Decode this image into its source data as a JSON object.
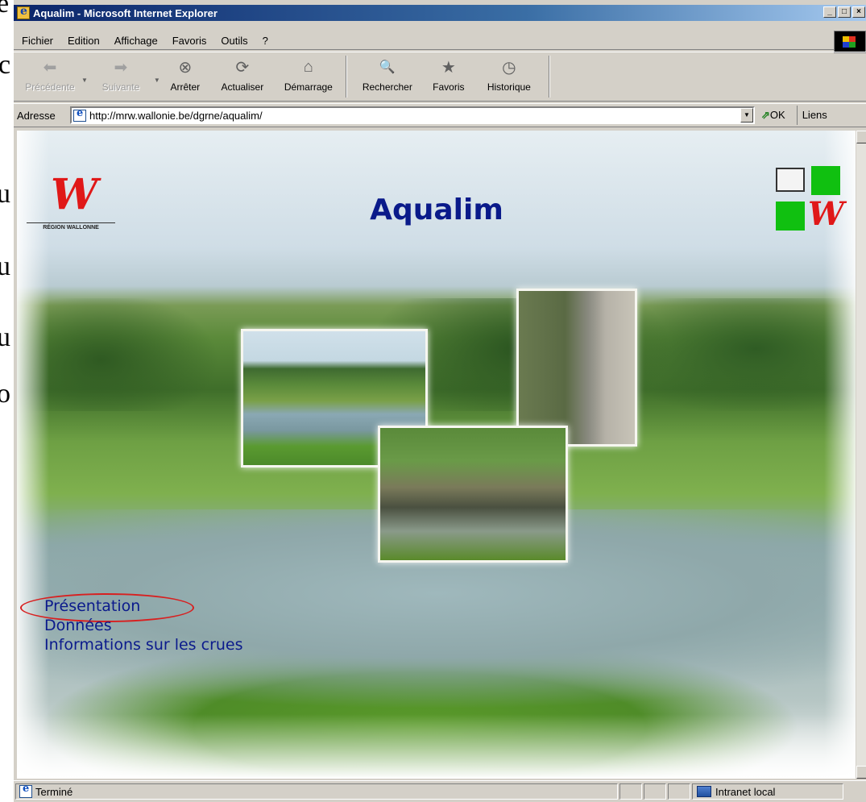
{
  "background_fragments": [
    {
      "text": "e"
    },
    {
      "text": "c"
    },
    {
      "text": "u"
    },
    {
      "text": "u"
    },
    {
      "text": "u"
    },
    {
      "text": "o"
    }
  ],
  "window": {
    "title": "Aqualim - Microsoft Internet Explorer",
    "controls": {
      "minimize": "_",
      "maximize": "□",
      "close": "×"
    }
  },
  "menu": {
    "items": [
      "Fichier",
      "Edition",
      "Affichage",
      "Favoris",
      "Outils",
      "?"
    ]
  },
  "toolbar": {
    "buttons": [
      {
        "label": "Précédente",
        "icon": "back-arrow-icon",
        "glyph": "⬅",
        "enabled": false,
        "dropdown": true
      },
      {
        "label": "Suivante",
        "icon": "forward-arrow-icon",
        "glyph": "➡",
        "enabled": false,
        "dropdown": true
      },
      {
        "label": "Arrêter",
        "icon": "stop-icon",
        "glyph": "⊗",
        "enabled": true
      },
      {
        "label": "Actualiser",
        "icon": "refresh-icon",
        "glyph": "⟳",
        "enabled": true
      },
      {
        "label": "Démarrage",
        "icon": "home-icon",
        "glyph": "⌂",
        "enabled": true
      },
      {
        "label": "Rechercher",
        "icon": "search-icon",
        "glyph": "🔍",
        "enabled": true
      },
      {
        "label": "Favoris",
        "icon": "favorites-icon",
        "glyph": "★",
        "enabled": true
      },
      {
        "label": "Historique",
        "icon": "history-icon",
        "glyph": "◷",
        "enabled": true
      }
    ]
  },
  "address": {
    "label": "Adresse",
    "url": "http://mrw.wallonie.be/dgrne/aqualim/",
    "go_label": "OK",
    "go_glyph": "⇗",
    "links_label": "Liens"
  },
  "page": {
    "title": "Aqualim",
    "logo_left_text": "RÉGION WALLONNE",
    "logo_glyph": "W",
    "nav_links": [
      "Présentation",
      "Données",
      "Informations sur les crues"
    ],
    "highlighted_link_index": 0,
    "highlight_color": "#d82020",
    "link_color": "#0b1a8c"
  },
  "status": {
    "text": "Terminé",
    "zone": "Intranet local"
  }
}
